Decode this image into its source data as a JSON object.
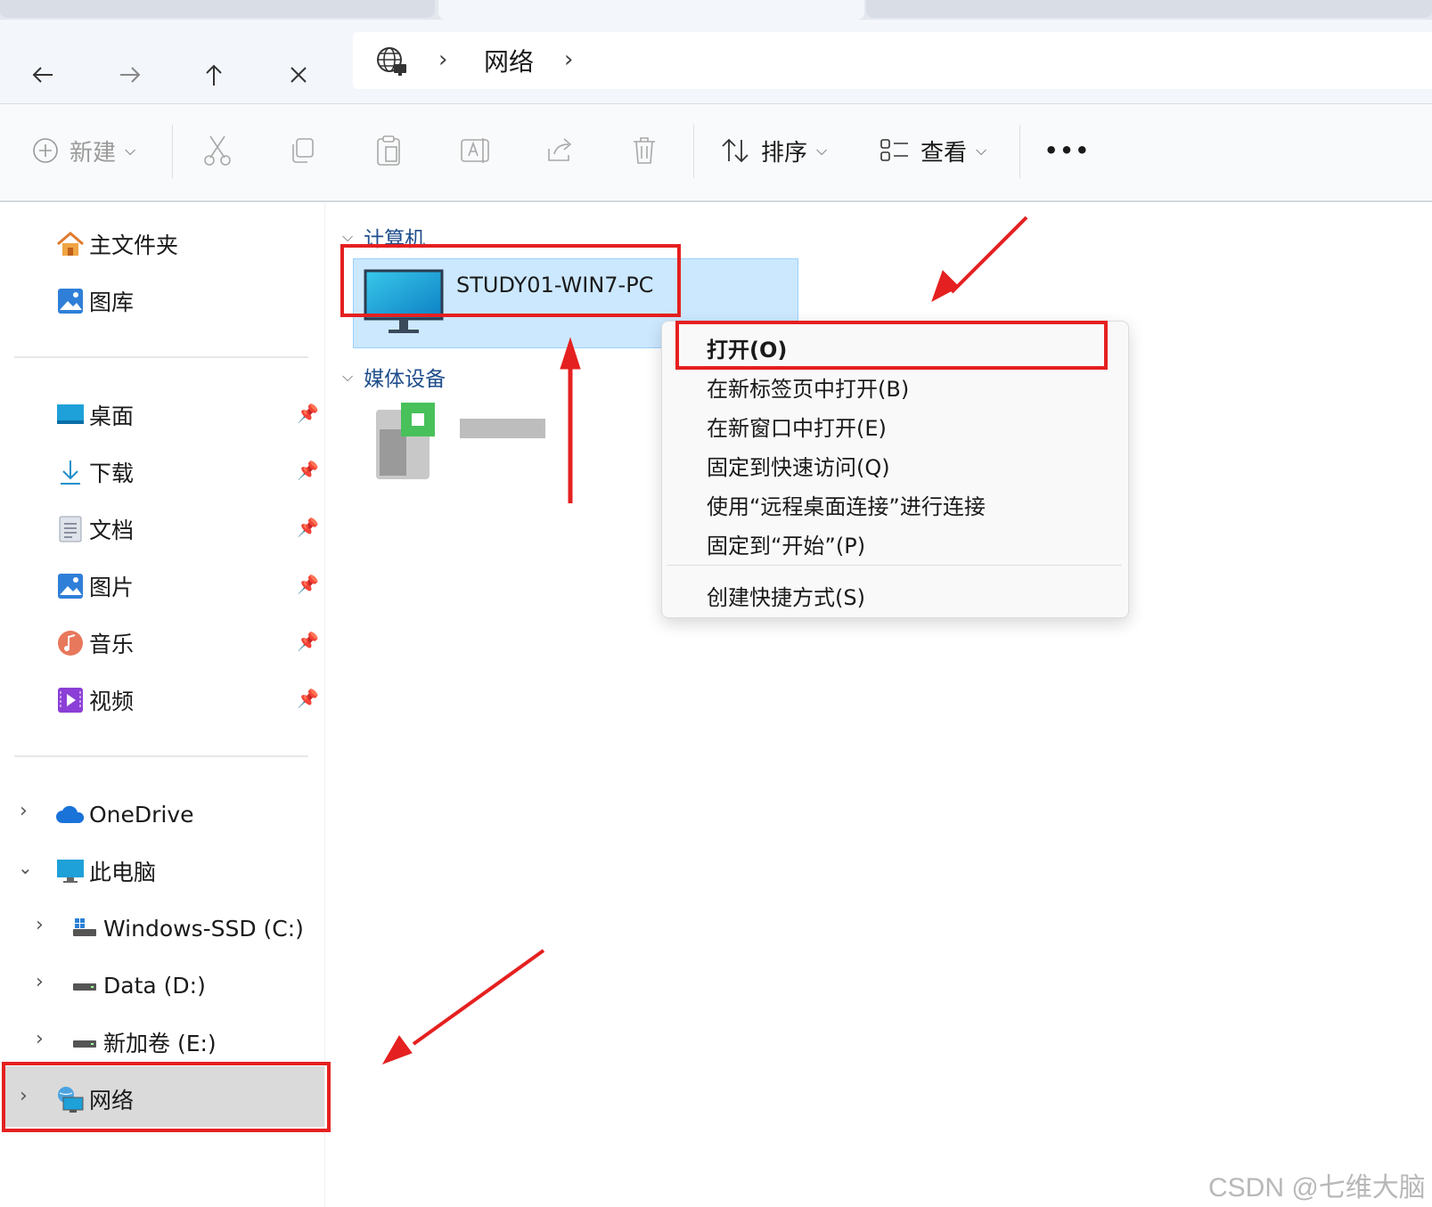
{
  "window": {
    "address": {
      "crumb": "网络"
    }
  },
  "nav": {
    "back_icon": "arrow-left-icon",
    "forward_icon": "arrow-right-icon",
    "up_icon": "arrow-up-icon",
    "close_icon": "close-icon"
  },
  "toolbar": {
    "new_label": "新建",
    "sort_label": "排序",
    "view_label": "查看",
    "more_label": "•••"
  },
  "sidebar": {
    "home": "主文件夹",
    "gallery": "图库",
    "quick": [
      {
        "label": "桌面",
        "icon": "desktop-icon"
      },
      {
        "label": "下载",
        "icon": "download-icon"
      },
      {
        "label": "文档",
        "icon": "document-icon"
      },
      {
        "label": "图片",
        "icon": "picture-icon"
      },
      {
        "label": "音乐",
        "icon": "music-icon"
      },
      {
        "label": "视频",
        "icon": "video-icon"
      }
    ],
    "onedrive": "OneDrive",
    "thispc": "此电脑",
    "drives": [
      {
        "label": "Windows-SSD (C:)"
      },
      {
        "label": "Data (D:)"
      },
      {
        "label": "新加卷 (E:)"
      }
    ],
    "network": "网络"
  },
  "content": {
    "group_computer": "计算机",
    "computer_name": "STUDY01-WIN7-PC",
    "group_media": "媒体设备"
  },
  "context_menu": {
    "items": [
      "打开(O)",
      "在新标签页中打开(B)",
      "在新窗口中打开(E)",
      "固定到快速访问(Q)",
      "使用“远程桌面连接”进行连接",
      "固定到“开始”(P)",
      "创建快捷方式(S)"
    ]
  },
  "watermark": "CSDN @七维大脑",
  "colors": {
    "accent": "#1f4e8c",
    "highlight_red": "#e52020",
    "selection": "#cce8ff"
  }
}
